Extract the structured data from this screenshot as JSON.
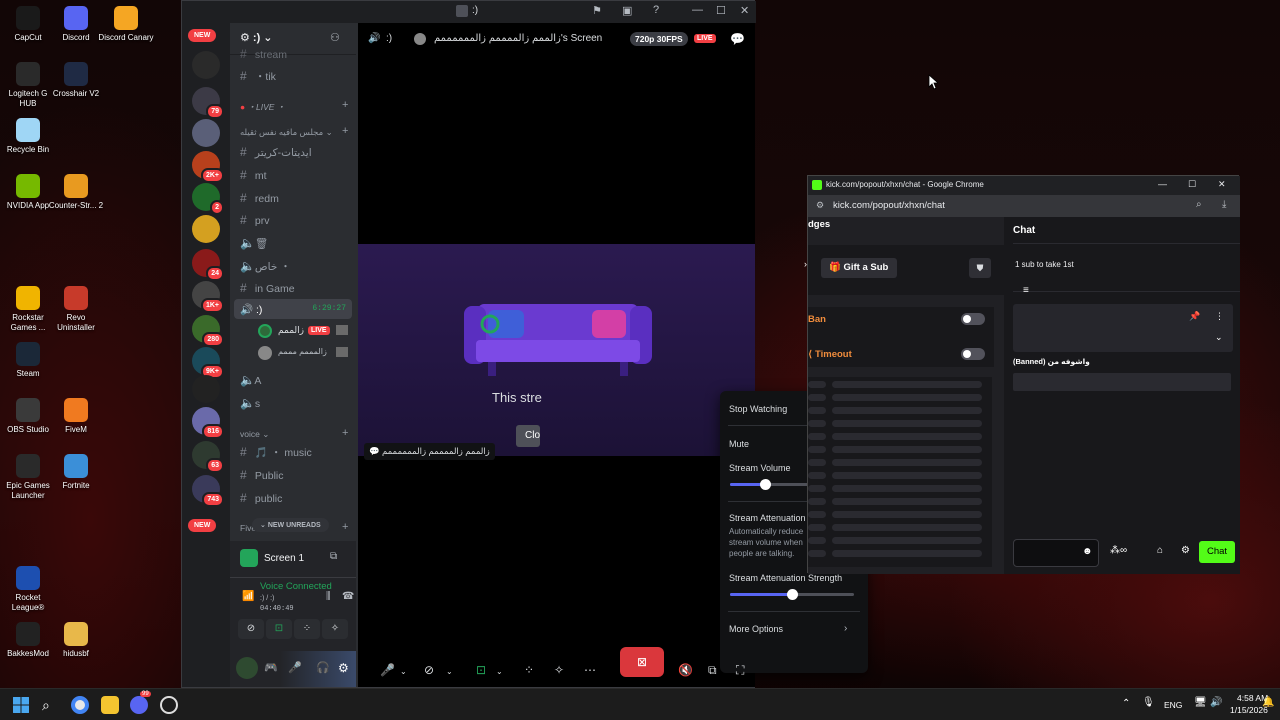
{
  "desktop_icons": [
    {
      "label": "CapCut",
      "color": "#1a1a1a"
    },
    {
      "label": "Discord",
      "color": "#5865f2"
    },
    {
      "label": "Discord Canary",
      "color": "#f5a623"
    },
    {
      "label": "Logitech G HUB",
      "color": "#2a2a2a"
    },
    {
      "label": "Crosshair V2",
      "color": "#1f2a44"
    },
    {
      "label": "Recycle Bin",
      "color": "#9fd6f5"
    },
    {
      "label": "NVIDIA App",
      "color": "#76b900"
    },
    {
      "label": "Counter-Str... 2",
      "color": "#e89a20"
    },
    {
      "label": "Rockstar Games ...",
      "color": "#f0b400"
    },
    {
      "label": "Revo Uninstaller",
      "color": "#c73a2a"
    },
    {
      "label": "Steam",
      "color": "#1b2838"
    },
    {
      "label": "OBS Studio",
      "color": "#3a3a3a"
    },
    {
      "label": "FiveM",
      "color": "#f07a20"
    },
    {
      "label": "Epic Games Launcher",
      "color": "#2a2a2a"
    },
    {
      "label": "Fortnite",
      "color": "#3b8fd8"
    },
    {
      "label": "Rocket League®",
      "color": "#1d4fb0"
    },
    {
      "label": "BakkesMod",
      "color": "#222"
    },
    {
      "label": "hidusbf",
      "color": "#e8b84a"
    }
  ],
  "discord": {
    "window_title": ":)",
    "server_badges": [
      "NEW",
      "79",
      "2K+",
      "2",
      "24",
      "1K+",
      "280",
      "9K+",
      "816",
      "63",
      "743",
      "NEW"
    ],
    "guild_name": ":)",
    "channels": [
      {
        "name": "stream",
        "type": "text"
      },
      {
        "name": "・tik",
        "type": "text"
      },
      {
        "name": "・LIVE ・",
        "type": "live"
      },
      {
        "name": "مجلس مافيه نفس ثقيله",
        "type": "section"
      },
      {
        "name": "ايديتات-كريتر",
        "type": "text"
      },
      {
        "name": "mt",
        "type": "text"
      },
      {
        "name": "redm",
        "type": "text"
      },
      {
        "name": "prv",
        "type": "text"
      },
      {
        "name": "🗑",
        "type": "voice"
      },
      {
        "name": "خاص ・",
        "type": "voice"
      },
      {
        "name": "in Game",
        "type": "text"
      },
      {
        "name": ":)",
        "type": "voice-active",
        "time": "6:29:27"
      },
      {
        "name": "زالممم",
        "type": "member",
        "live": "LIVE"
      },
      {
        "name": "زالمممم مممم",
        "type": "member"
      },
      {
        "name": "A",
        "type": "voice"
      },
      {
        "name": "s",
        "type": "voice"
      },
      {
        "name": "voice",
        "type": "section"
      },
      {
        "name": "🎵 ・ music",
        "type": "text"
      },
      {
        "name": "Public",
        "type": "text"
      },
      {
        "name": "public",
        "type": "text"
      },
      {
        "name": "Five",
        "type": "section"
      }
    ],
    "new_unreads": "NEW UNREADS",
    "screen_panel": {
      "title": "Screen 1",
      "status": "Voice Connected",
      "channel": ":) / :)",
      "elapsed": "04:40:49"
    },
    "stream": {
      "header_channel": ":)",
      "header_title": "زالممم زالممممم زالممممممم's Screen",
      "quality": "720p 30FPS",
      "live": "LIVE",
      "overlay_text": "This stre",
      "close_label": "Clo",
      "streamer_tag": "زالممم زالممممم زالممممممم"
    },
    "popup": {
      "stop_watching": "Stop Watching",
      "mute": "Mute",
      "mute_checked": true,
      "stream_volume": "Stream Volume",
      "stream_volume_pct": 0.28,
      "attenuation": "Stream Attenuation",
      "attenuation_desc": "Automatically reduce stream volume when people are talking.",
      "attenuation_checked": true,
      "attenuation_strength": "Stream Attenuation Strength",
      "attenuation_strength_pct": 0.5,
      "more_options": "More Options"
    }
  },
  "chrome": {
    "title": "kick.com/popout/xhxn/chat - Google Chrome",
    "url": "kick.com/popout/xhxn/chat",
    "left_header": "dges",
    "gift_sub": "Gift a Sub",
    "ban": "Ban",
    "timeout": "Timeout",
    "chat_title": "Chat",
    "sub_text": "1 sub to take 1st",
    "banned_text": "(Banned) واشوفه من",
    "chat_button": "Chat",
    "accent": "#53fc18"
  },
  "taskbar": {
    "lang": "ENG",
    "time": "4:58 AM",
    "date": "1/15/2026",
    "discord_badge": "99"
  }
}
